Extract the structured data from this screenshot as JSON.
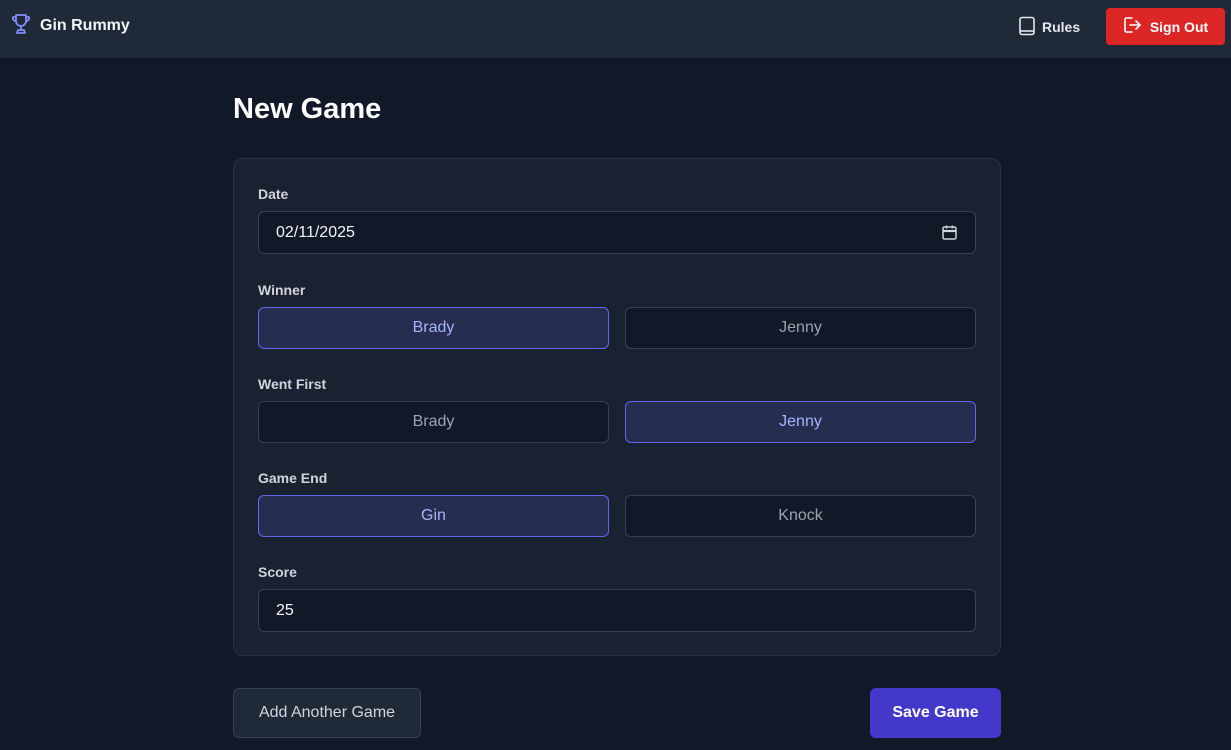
{
  "header": {
    "brand_name": "Gin Rummy",
    "brand_icon": "trophy-icon",
    "rules_label": "Rules",
    "rules_icon": "book-icon",
    "signout_label": "Sign Out",
    "signout_icon": "sign-out-icon"
  },
  "page": {
    "title": "New Game"
  },
  "form": {
    "date": {
      "label": "Date",
      "value": "02/11/2025",
      "icon": "calendar-icon"
    },
    "winner": {
      "label": "Winner",
      "options": [
        "Brady",
        "Jenny"
      ],
      "selected": "Brady"
    },
    "went_first": {
      "label": "Went First",
      "options": [
        "Brady",
        "Jenny"
      ],
      "selected": "Jenny"
    },
    "game_end": {
      "label": "Game End",
      "options": [
        "Gin",
        "Knock"
      ],
      "selected": "Gin"
    },
    "score": {
      "label": "Score",
      "value": "25"
    }
  },
  "actions": {
    "add_another_label": "Add Another Game",
    "save_label": "Save Game"
  },
  "colors": {
    "background": "#111827",
    "navbar": "#1f2937",
    "accent": "#6366f1",
    "primary_button": "#4338ca",
    "danger": "#dc2626"
  }
}
